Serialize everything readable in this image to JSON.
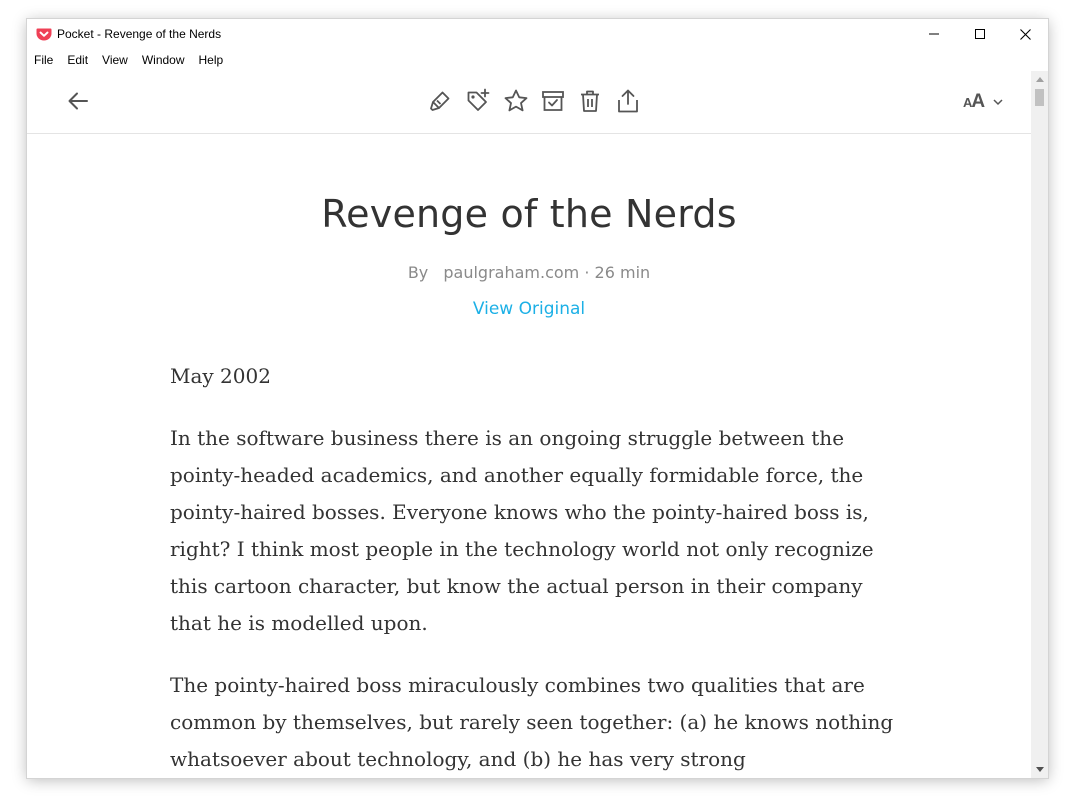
{
  "window": {
    "title": "Pocket - Revenge of the Nerds"
  },
  "menu": {
    "items": [
      "File",
      "Edit",
      "View",
      "Window",
      "Help"
    ]
  },
  "toolbar": {
    "back_icon": "arrow-left-icon",
    "actions": [
      "highlighter-icon",
      "tag-add-icon",
      "star-icon",
      "archive-icon",
      "trash-icon",
      "share-icon"
    ],
    "display_settings_icon": "font-size-icon"
  },
  "article": {
    "title": "Revenge of the Nerds",
    "by_label": "By",
    "source": "paulgraham.com",
    "separator": "·",
    "read_time": "26 min",
    "view_original": "View Original",
    "paragraphs": [
      "May 2002",
      "In the software business there is an ongoing struggle between the pointy-headed academics, and another equally formidable force, the pointy-haired bosses. Everyone knows who the pointy-haired boss is, right? I think most people in the technology world not only recognize this cartoon character, but know the actual person in their company that he is modelled upon.",
      "The pointy-haired boss miraculously combines two qualities that are common by themselves, but rarely seen together: (a) he knows nothing whatsoever about technology, and (b) he has very strong"
    ]
  },
  "colors": {
    "brand": "#ef4056",
    "link": "#1cb0e6",
    "text": "#333333",
    "muted": "#8a8a8a"
  }
}
